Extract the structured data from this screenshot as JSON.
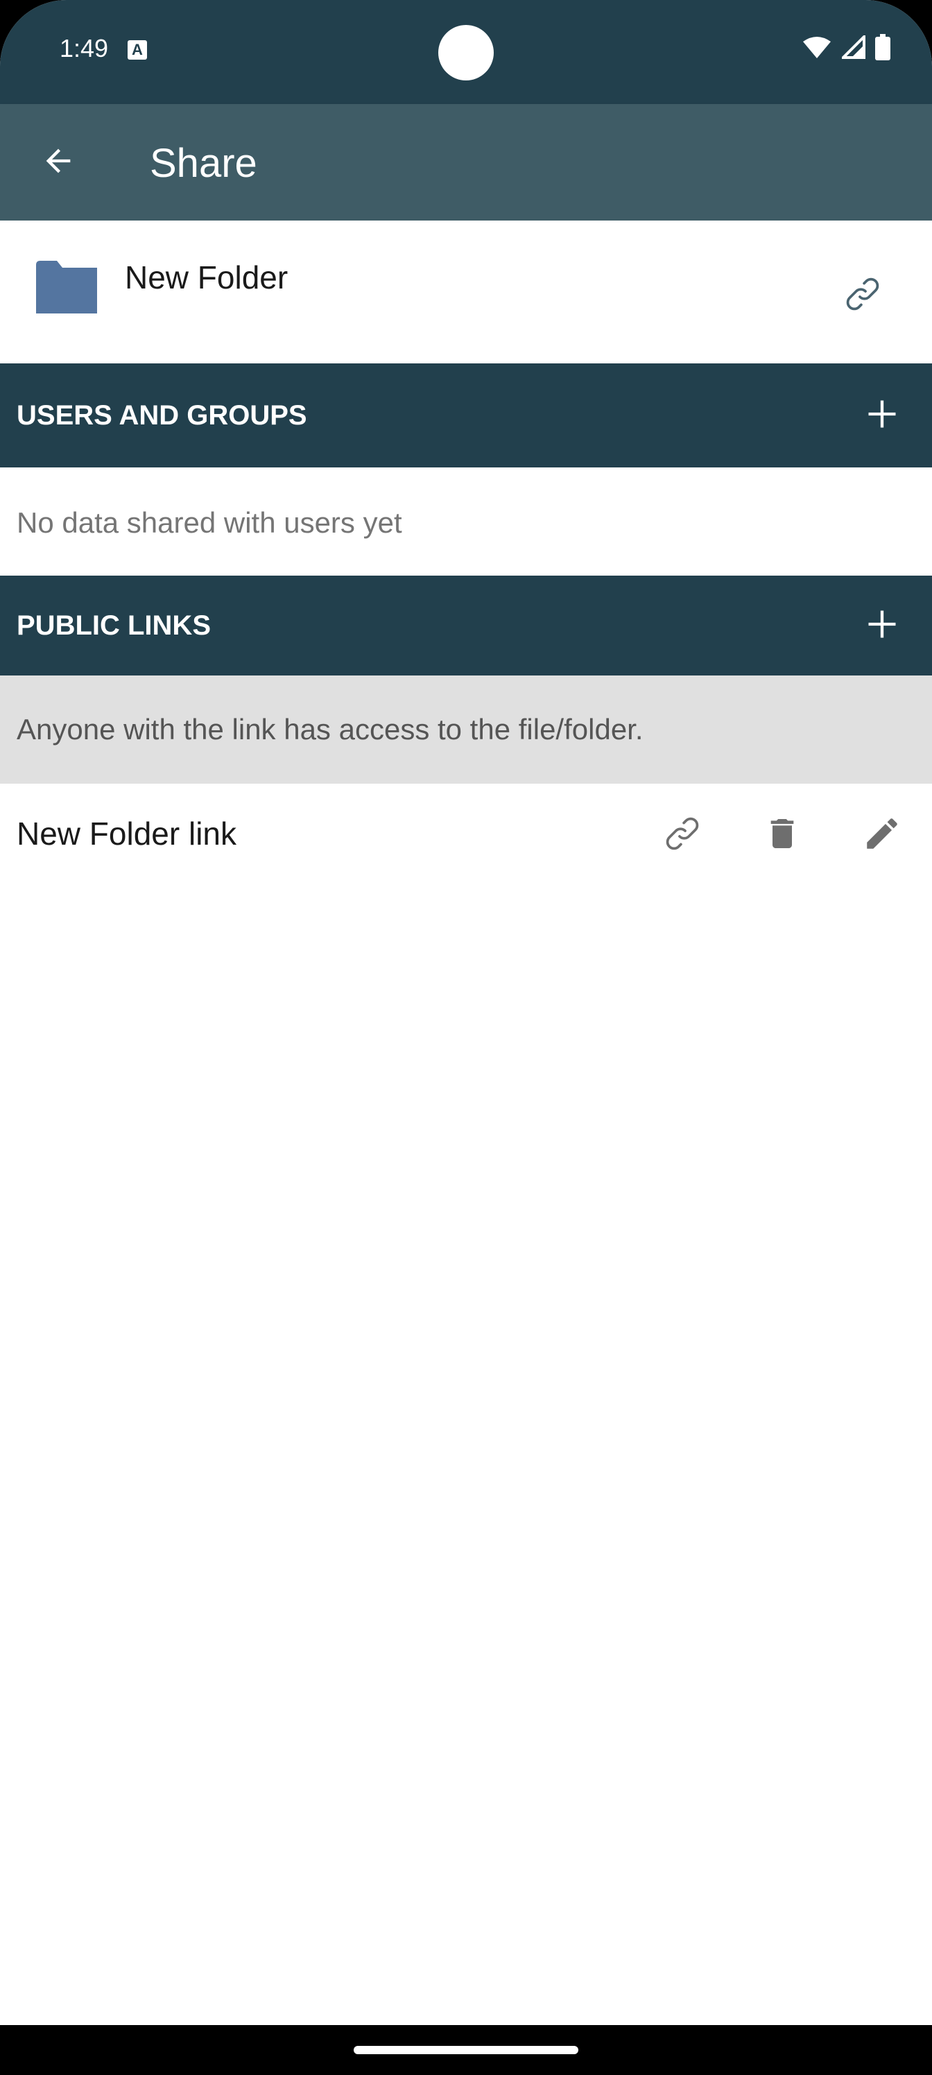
{
  "status_bar": {
    "time": "1:49",
    "notification_icon": "a-letter-icon",
    "notification_letter": "A",
    "icons": [
      "wifi-icon",
      "signal-icon",
      "battery-icon"
    ]
  },
  "toolbar": {
    "back_icon": "arrow-back-icon",
    "title": "Share"
  },
  "file": {
    "icon": "folder-icon",
    "name": "New Folder",
    "action_icon": "link-icon"
  },
  "users_groups": {
    "title": "USERS AND GROUPS",
    "add_icon": "plus-icon",
    "empty_text": "No data shared with users yet"
  },
  "public_links": {
    "title": "PUBLIC LINKS",
    "add_icon": "plus-icon",
    "notice": "Anyone with the link has access to the file/folder.",
    "links": [
      {
        "name": "New Folder link",
        "actions": [
          "link-icon",
          "trash-icon",
          "pencil-icon"
        ]
      }
    ]
  },
  "colors": {
    "status_bar": "#22404d",
    "toolbar": "#3f5c66",
    "section_header": "#22404d",
    "folder": "#5475a0",
    "notice_bg": "#e0e0e0",
    "icon_gray": "#6e6e6e"
  }
}
